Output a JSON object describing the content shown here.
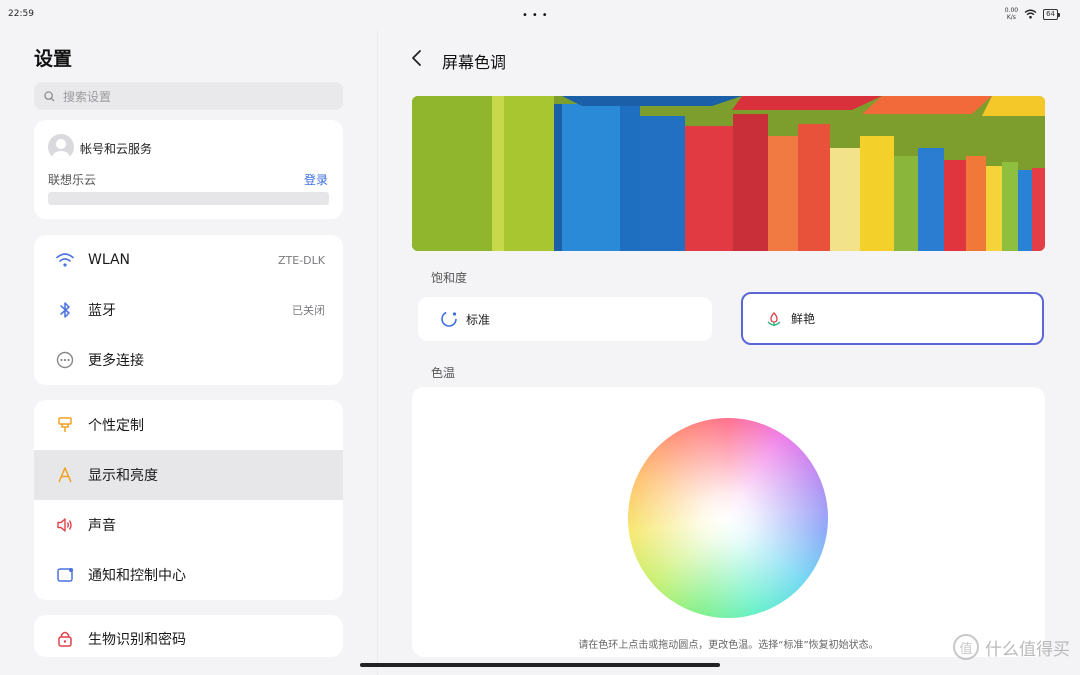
{
  "status_bar": {
    "time": "22:59",
    "net_speed_value": "0.00",
    "net_speed_unit": "K/s",
    "battery": "64"
  },
  "left": {
    "title": "设置",
    "search": {
      "placeholder": "搜索设置"
    },
    "account": {
      "title": "帐号和云服务",
      "subtitle": "联想乐云",
      "login": "登录"
    },
    "group1": [
      {
        "label": "WLAN",
        "value": "ZTE-DLK",
        "icon": "wifi-icon"
      },
      {
        "label": "蓝牙",
        "value": "已关闭",
        "icon": "bluetooth-icon"
      },
      {
        "label": "更多连接",
        "value": "",
        "icon": "more-connections-icon"
      }
    ],
    "group2": [
      {
        "label": "个性定制",
        "icon": "personalize-icon"
      },
      {
        "label": "显示和亮度",
        "icon": "display-icon",
        "selected": true
      },
      {
        "label": "声音",
        "icon": "speaker-icon"
      },
      {
        "label": "通知和控制中心",
        "icon": "notification-icon"
      }
    ],
    "group3": [
      {
        "label": "生物识别和密码",
        "icon": "lock-icon"
      }
    ]
  },
  "right": {
    "title": "屏幕色调",
    "saturation_label": "饱和度",
    "saturation_options": [
      {
        "label": "标准",
        "selected": false
      },
      {
        "label": "鲜艳",
        "selected": true
      }
    ],
    "temperature_label": "色温",
    "hint": "请在色环上点击或拖动圆点，更改色温。选择“标准”恢复初始状态。"
  },
  "watermark": "什么值得买",
  "colors": {
    "accent": "#3b6fe0",
    "selected_border": "#5b67d6"
  }
}
